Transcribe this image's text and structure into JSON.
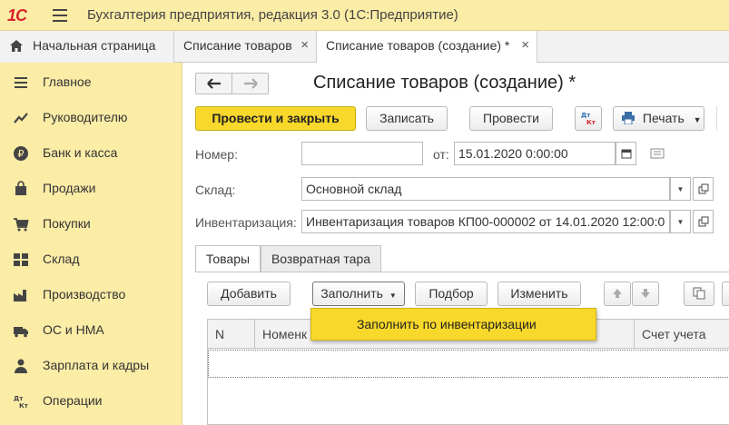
{
  "app": {
    "logo": "1С",
    "title": "Бухгалтерия предприятия, редакция 3.0  (1С:Предприятие)"
  },
  "tabs": [
    {
      "label": "Начальная страница",
      "icon": "home-icon"
    },
    {
      "label": "Списание товаров",
      "close": "×"
    },
    {
      "label": "Списание товаров (создание) *",
      "close": "×",
      "active": true
    }
  ],
  "sidebar": {
    "items": [
      {
        "label": "Главное",
        "icon": "menu-lines-icon"
      },
      {
        "label": "Руководителю",
        "icon": "trend-chart-icon"
      },
      {
        "label": "Банк и касса",
        "icon": "ruble-coin-icon"
      },
      {
        "label": "Продажи",
        "icon": "shopping-bag-icon"
      },
      {
        "label": "Покупки",
        "icon": "shopping-cart-icon"
      },
      {
        "label": "Склад",
        "icon": "warehouse-grid-icon"
      },
      {
        "label": "Производство",
        "icon": "factory-icon"
      },
      {
        "label": "ОС и НМА",
        "icon": "truck-icon"
      },
      {
        "label": "Зарплата и кадры",
        "icon": "person-icon"
      },
      {
        "label": "Операции",
        "icon": "dt-kt-icon"
      }
    ]
  },
  "document": {
    "title": "Списание товаров (создание) *",
    "nav": {
      "back": "🡐",
      "forward": "🡒"
    }
  },
  "toolbar": {
    "post_close": "Провести и закрыть",
    "save": "Записать",
    "post": "Провести",
    "dtkt": "Дт Кт",
    "print": "Печать"
  },
  "form": {
    "number_label": "Номер:",
    "number_value": "",
    "date_label": "от:",
    "date_value": "15.01.2020  0:00:00",
    "warehouse_label": "Склад:",
    "warehouse_value": "Основной склад",
    "inventory_label": "Инвентаризация:",
    "inventory_value": "Инвентаризация товаров КП00-000002 от 14.01.2020 12:00:0"
  },
  "subtabs": [
    {
      "label": "Товары",
      "active": true
    },
    {
      "label": "Возвратная тара",
      "active": false
    }
  ],
  "table_toolbar": {
    "add": "Добавить",
    "fill": "Заполнить",
    "select": "Подбор",
    "change": "Изменить"
  },
  "table": {
    "columns": [
      "N",
      "Номенк",
      "Счет учета"
    ]
  },
  "dropdown": {
    "item": "Заполнить по инвентаризации"
  },
  "colors": {
    "accent_yellow": "#f8d82a",
    "sidebar_bg": "#fbeca6",
    "logo_red": "#d9232e"
  }
}
